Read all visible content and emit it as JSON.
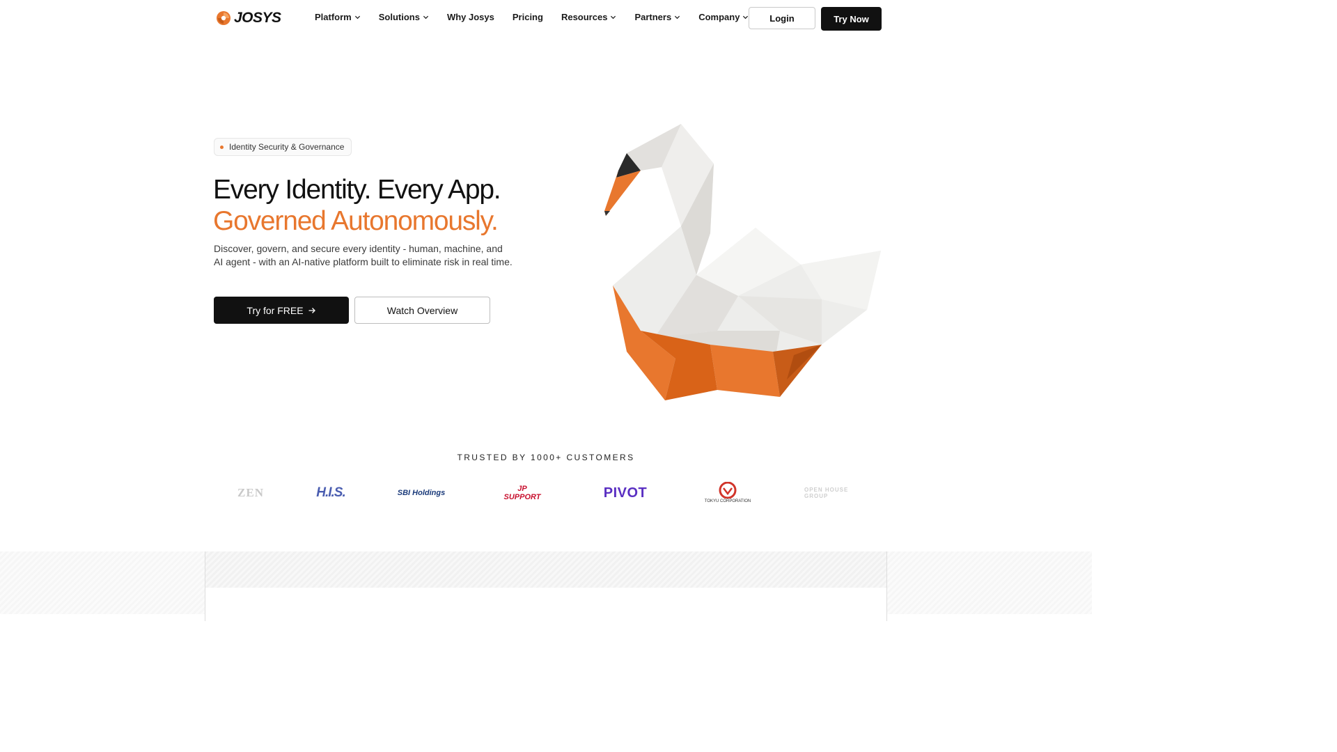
{
  "nav": {
    "logo_text": "JOSYS",
    "items": [
      {
        "label": "Platform",
        "dropdown": true
      },
      {
        "label": "Solutions",
        "dropdown": true
      },
      {
        "label": "Why Josys",
        "dropdown": false
      },
      {
        "label": "Pricing",
        "dropdown": false
      },
      {
        "label": "Resources",
        "dropdown": true
      },
      {
        "label": "Partners",
        "dropdown": true
      },
      {
        "label": "Company",
        "dropdown": true
      }
    ],
    "login_label": "Login",
    "try_now_label": "Try Now"
  },
  "hero": {
    "badge": "Identity Security & Governance",
    "headline_line1": "Every Identity. Every App.",
    "headline_line2": "Governed Autonomously.",
    "subtitle": "Discover, govern, and secure every identity - human, machine, and AI agent - with an AI-native platform built to eliminate risk in real time.",
    "cta_primary": "Try for FREE",
    "cta_secondary": "Watch Overview"
  },
  "customers": {
    "heading": "TRUSTED BY 1000+ CUSTOMERS",
    "logos": [
      "ZEN",
      "H.I.S.",
      "SBI Holdings",
      "JP SUPPORT",
      "PIVOT",
      "TOKYU CORPORATION",
      "OPEN HOUSE GROUP"
    ]
  },
  "colors": {
    "accent": "#e8772e",
    "primary_button": "#111111",
    "text": "#111111"
  }
}
